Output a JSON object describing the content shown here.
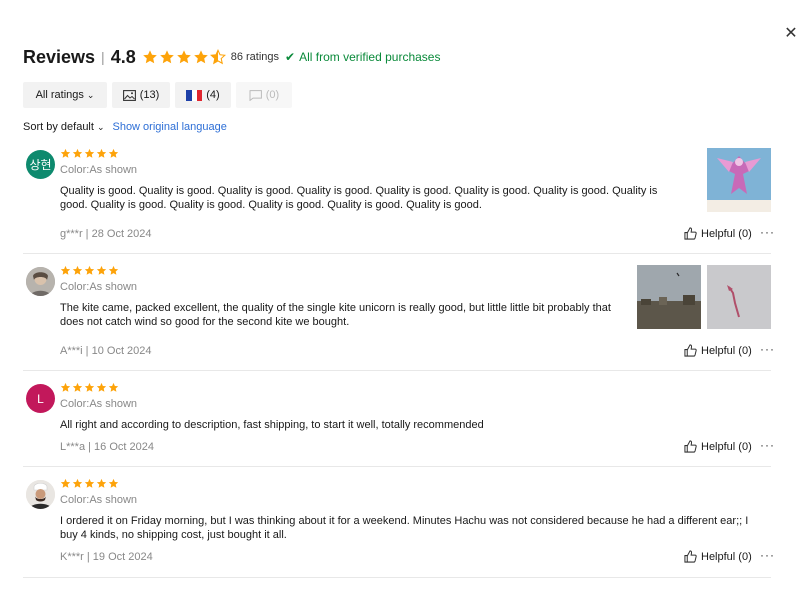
{
  "header": {
    "title": "Reviews",
    "separator": "|",
    "score": "4.8",
    "rating_value": 4.8,
    "rating_count": "86 ratings",
    "verified": "All from verified purchases"
  },
  "filters": {
    "all": "All ratings",
    "photos": "(13)",
    "country": "(4)",
    "comments": "(0)"
  },
  "sort": {
    "label": "Sort by default",
    "language": "Show original language"
  },
  "reviews": [
    {
      "avatar_text": "상현",
      "avatar_color": "#0e8a6e",
      "stars": 5,
      "color": "Color:As shown",
      "text": "Quality is good. Quality is good. Quality is good. Quality is good. Quality is good. Quality is good. Quality is good. Quality is good. Quality is good. Quality is good. Quality is good. Quality is good. Quality is good.",
      "meta": "g***r | 28 Oct 2024",
      "helpful": "Helpful (0)",
      "more": "···"
    },
    {
      "avatar_text": "",
      "avatar_color": "#9a9a9a",
      "stars": 5,
      "color": "Color:As shown",
      "text": "The kite came, packed excellent, the quality of the single kite unicorn is really good, but little little bit probably that does not catch wind so good for the second kite we bought.",
      "meta": "A***i | 10 Oct 2024",
      "helpful": "Helpful (0)",
      "more": "···"
    },
    {
      "avatar_text": "L",
      "avatar_color": "#c2185b",
      "stars": 5,
      "color": "Color:As shown",
      "text": "All right and according to description, fast shipping, to start it well, totally recommended",
      "meta": "L***a | 16 Oct 2024",
      "helpful": "Helpful (0)",
      "more": "···"
    },
    {
      "avatar_text": "",
      "avatar_color": "#e7e0d8",
      "stars": 5,
      "color": "Color:As shown",
      "text": "I ordered it on Friday morning, but I was thinking about it for a weekend. Minutes Hachu was not considered because he had a different ear;; I buy 4 kinds, no shipping cost, just bought it all.",
      "meta": "K***r | 19 Oct 2024",
      "helpful": "Helpful (0)",
      "more": "···"
    }
  ],
  "colors": {
    "star": "#fda30a",
    "verified": "#0a8a3a",
    "link": "#2e6fd6"
  },
  "icons": {
    "close": "close-icon",
    "verified": "check-icon",
    "photo": "image-icon",
    "comment": "comment-icon",
    "helpful": "thumbs-up-icon"
  }
}
